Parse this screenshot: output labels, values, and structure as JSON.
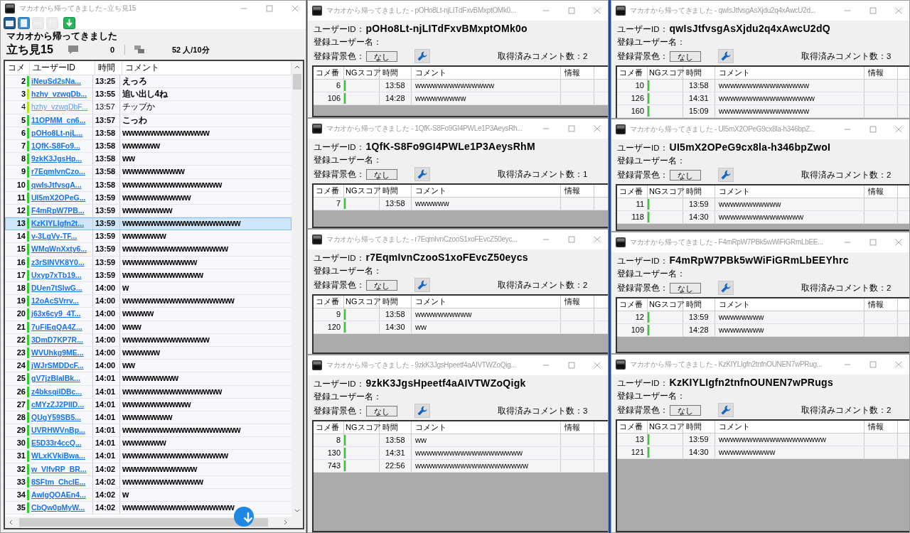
{
  "main_window": {
    "title": "マカオから帰ってきました - 立ち見15",
    "toolbar": [
      {
        "kind": "window",
        "disabled": false
      },
      {
        "kind": "document",
        "disabled": false
      },
      {
        "kind": "blank",
        "disabled": true
      },
      {
        "kind": "grid",
        "disabled": true
      },
      {
        "kind": "download",
        "disabled": false
      }
    ],
    "header": {
      "title": "マカオから帰ってきました",
      "room": "立ち見15",
      "comment_count": "0",
      "viewers": "52 人/10分"
    },
    "list": {
      "columns": [
        "コメ",
        "ユーザーID",
        "時間",
        "コメント"
      ],
      "rows": [
        {
          "no": "2",
          "user": "iNeuSd2sNa...",
          "time": "13:25",
          "comment": "えっろ",
          "color": "#33cc33",
          "bold": true,
          "selected": false
        },
        {
          "no": "3",
          "user": "hzhy_vzwqDb...",
          "time": "13:55",
          "comment": "追い出し4ね",
          "color": "#b5e61d",
          "bold": true,
          "selected": false
        },
        {
          "no": "4",
          "user": "hzhy_vzwqDbF...",
          "time": "13:57",
          "comment": "チップか",
          "color": "#b5e61d",
          "bold": false,
          "selected": false
        },
        {
          "no": "5",
          "user": "11OPMM_cn6...",
          "time": "13:57",
          "comment": "こっわ",
          "color": "#33cc33",
          "bold": true,
          "selected": false
        },
        {
          "no": "6",
          "user": "pOHo8Lt-njL...",
          "time": "13:58",
          "comment": "wwwwwwwwwwwwww",
          "color": "#33cc33",
          "bold": true,
          "selected": false
        },
        {
          "no": "7",
          "user": "1QfK-S8Fo9...",
          "time": "13:58",
          "comment": "wwwwww",
          "color": "#33cc33",
          "bold": true,
          "selected": false
        },
        {
          "no": "8",
          "user": "9zkK3JgsHp...",
          "time": "13:58",
          "comment": "ww",
          "color": "#33cc33",
          "bold": true,
          "selected": false
        },
        {
          "no": "9",
          "user": "r7EqmIvnCzo...",
          "time": "13:58",
          "comment": "wwwwwwwwww",
          "color": "#33cc33",
          "bold": true,
          "selected": false
        },
        {
          "no": "10",
          "user": "qwIsJtfvsgA...",
          "time": "13:58",
          "comment": "wwwwwwwwwwwwwwww",
          "color": "#33cc33",
          "bold": true,
          "selected": false
        },
        {
          "no": "11",
          "user": "UI5mX2OPeG...",
          "time": "13:59",
          "comment": "wwwwwwwwwww",
          "color": "#33cc33",
          "bold": true,
          "selected": false
        },
        {
          "no": "12",
          "user": "F4mRpW7PB...",
          "time": "13:59",
          "comment": "wwwwwwww",
          "color": "#33cc33",
          "bold": true,
          "selected": false
        },
        {
          "no": "13",
          "user": "KzKIYLIgfn2t...",
          "time": "13:59",
          "comment": "wwwwwwwwwwwwwwwwwww",
          "color": "#33cc33",
          "bold": true,
          "selected": true
        },
        {
          "no": "14",
          "user": "v-3LgVy-TF...",
          "time": "13:59",
          "comment": "wwwwwww",
          "color": "#33cc33",
          "bold": true,
          "selected": false
        },
        {
          "no": "15",
          "user": "WMqWnXxty6...",
          "time": "13:59",
          "comment": "wwwwwwwwwwwwwwwww",
          "color": "#33cc33",
          "bold": true,
          "selected": false
        },
        {
          "no": "16",
          "user": "z3rSINVK8Y0...",
          "time": "13:59",
          "comment": "wwwwwwwwwwww",
          "color": "#33cc33",
          "bold": true,
          "selected": false
        },
        {
          "no": "17",
          "user": "Uxyp7xTb19...",
          "time": "13:59",
          "comment": "wwwwwwwwwwwww",
          "color": "#33cc33",
          "bold": true,
          "selected": false
        },
        {
          "no": "18",
          "user": "DUen7tSlwG...",
          "time": "14:00",
          "comment": "w",
          "color": "#33cc33",
          "bold": true,
          "selected": false
        },
        {
          "no": "19",
          "user": "12oAcSVrrv...",
          "time": "14:00",
          "comment": "wwwwwwwwwwwwwwwwww",
          "color": "#33cc33",
          "bold": true,
          "selected": false
        },
        {
          "no": "20",
          "user": "j63x6cy9_4T...",
          "time": "14:00",
          "comment": "wwwww",
          "color": "#33cc33",
          "bold": true,
          "selected": false
        },
        {
          "no": "21",
          "user": "7uFiEqQA4Z...",
          "time": "14:00",
          "comment": "www",
          "color": "#33cc33",
          "bold": true,
          "selected": false
        },
        {
          "no": "22",
          "user": "3DmD7KP7R...",
          "time": "14:00",
          "comment": "wwwwwwwwwwwwww",
          "color": "#33cc33",
          "bold": true,
          "selected": false
        },
        {
          "no": "23",
          "user": "WVUhkg9ME...",
          "time": "14:00",
          "comment": "wwwwww",
          "color": "#33cc33",
          "bold": true,
          "selected": false
        },
        {
          "no": "24",
          "user": "jWJrSMDDcF...",
          "time": "14:00",
          "comment": "ww",
          "color": "#33cc33",
          "bold": true,
          "selected": false
        },
        {
          "no": "25",
          "user": "gV7jzBlaIBk...",
          "time": "14:01",
          "comment": "wwwwwwwww",
          "color": "#33cc33",
          "bold": true,
          "selected": false
        },
        {
          "no": "26",
          "user": "z4bksqilDBc...",
          "time": "14:01",
          "comment": "wwwwwwwwwwwwwwww",
          "color": "#33cc33",
          "bold": true,
          "selected": false
        },
        {
          "no": "27",
          "user": "cMYzZJ2PIID...",
          "time": "14:01",
          "comment": "wwwwwwwwwww",
          "color": "#33cc33",
          "bold": true,
          "selected": false
        },
        {
          "no": "28",
          "user": "QUgY59SB5...",
          "time": "14:01",
          "comment": "wwwwwwww",
          "color": "#33cc33",
          "bold": true,
          "selected": false
        },
        {
          "no": "29",
          "user": "UVRHWVnBp...",
          "time": "14:01",
          "comment": "wwwwwwwwwwwwwwwwwww",
          "color": "#33cc33",
          "bold": true,
          "selected": false
        },
        {
          "no": "30",
          "user": "E5D33r4ccQ...",
          "time": "14:01",
          "comment": "wwwwwww",
          "color": "#33cc33",
          "bold": true,
          "selected": false
        },
        {
          "no": "31",
          "user": "WLxKVkiBwa...",
          "time": "14:01",
          "comment": "wwwwwwwwwwwwwwwww",
          "color": "#33cc33",
          "bold": true,
          "selected": false
        },
        {
          "no": "32",
          "user": "w_VlfvRP_BR...",
          "time": "14:02",
          "comment": "wwwwwwwwwwww",
          "color": "#33cc33",
          "bold": true,
          "selected": false
        },
        {
          "no": "33",
          "user": "8SFtm_ChcIE...",
          "time": "14:02",
          "comment": "wwwwwwwwwwwww",
          "color": "#33cc33",
          "bold": true,
          "selected": false
        },
        {
          "no": "34",
          "user": "AwlgQOAEn4...",
          "time": "14:02",
          "comment": "w",
          "color": "#33cc33",
          "bold": true,
          "selected": false
        },
        {
          "no": "35",
          "user": "CbQw0pMyW...",
          "time": "14:02",
          "comment": "wwwwwwwwwwwwwwwwww",
          "color": "#33cc33",
          "bold": true,
          "selected": false
        }
      ]
    }
  },
  "user_windows": [
    {
      "title": "マカオから帰ってきました - pOHo8Lt-njLITdFxvBMxptOMk0...",
      "user_id_label": "ユーザーID：",
      "user_id": "pOHo8Lt-njLITdFxvBMxptOMk0o",
      "name_label": "登録ユーザー名：",
      "bg_label": "登録背景色：",
      "bg_value": "なし",
      "count_text": "取得済みコメント数：2",
      "columns": [
        "コメ番",
        "NGスコア",
        "時間",
        "コメント",
        "情報"
      ],
      "rows": [
        {
          "no": "6",
          "time": "13:58",
          "comment": "wwwwwwwwwwwwww"
        },
        {
          "no": "106",
          "time": "14:28",
          "comment": "wwwwwwwww"
        }
      ]
    },
    {
      "title": "マカオから帰ってきました - 1QfK-S8Fo9GI4PWLe1P3AeysRh...",
      "user_id_label": "ユーザーID：",
      "user_id": "1QfK-S8Fo9GI4PWLe1P3AeysRhM",
      "name_label": "登録ユーザー名：",
      "bg_label": "登録背景色：",
      "bg_value": "なし",
      "count_text": "取得済みコメント数：1",
      "columns": [
        "コメ番",
        "NGスコア",
        "時間",
        "コメント",
        "情報"
      ],
      "rows": [
        {
          "no": "7",
          "time": "13:58",
          "comment": "wwwwww"
        }
      ]
    },
    {
      "title": "マカオから帰ってきました - r7EqmIvnCzooS1xoFEvcZ50eyc...",
      "user_id_label": "ユーザーID：",
      "user_id": "r7EqmIvnCzooS1xoFEvcZ50eycs",
      "name_label": "登録ユーザー名：",
      "bg_label": "登録背景色：",
      "bg_value": "なし",
      "count_text": "取得済みコメント数：2",
      "columns": [
        "コメ番",
        "NGスコア",
        "時間",
        "コメント",
        "情報"
      ],
      "rows": [
        {
          "no": "9",
          "time": "13:58",
          "comment": "wwwwwwwwww"
        },
        {
          "no": "120",
          "time": "14:30",
          "comment": "ww"
        }
      ]
    },
    {
      "title": "マカオから帰ってきました - 9zkK3JgsHpeetf4aAIVTWZoQig...",
      "user_id_label": "ユーザーID：",
      "user_id": "9zkK3JgsHpeetf4aAIVTWZoQigk",
      "name_label": "登録ユーザー名：",
      "bg_label": "登録背景色：",
      "bg_value": "なし",
      "count_text": "取得済みコメント数：3",
      "columns": [
        "コメ番",
        "NGスコア",
        "時間",
        "コメント",
        "情報"
      ],
      "rows": [
        {
          "no": "8",
          "time": "13:58",
          "comment": "ww"
        },
        {
          "no": "130",
          "time": "14:31",
          "comment": "wwwwwwwwwwwwwwwwwww"
        },
        {
          "no": "743",
          "time": "22:56",
          "comment": "wwwwwwwwwwwwwwwwwwww"
        }
      ]
    },
    {
      "title": "マカオから帰ってきました - qwIsJtfvsgAsXjdu2q4xAwcU2d...",
      "user_id_label": "ユーザーID：",
      "user_id": "qwIsJtfvsgAsXjdu2q4xAwcU2dQ",
      "name_label": "登録ユーザー名：",
      "bg_label": "登録背景色：",
      "bg_value": "なし",
      "count_text": "取得済みコメント数：3",
      "columns": [
        "コメ番",
        "NGスコア",
        "時間",
        "コメント",
        "情報"
      ],
      "rows": [
        {
          "no": "10",
          "time": "13:58",
          "comment": "wwwwwwwwwwwwwwww"
        },
        {
          "no": "126",
          "time": "14:31",
          "comment": "wwwwwwwwwwwwwwwww"
        },
        {
          "no": "160",
          "time": "15:09",
          "comment": "wwwwwwwwwwwwwwww"
        }
      ]
    },
    {
      "title": "マカオから帰ってきました - UI5mX2OPeG9cx8la-h346bpZ...",
      "user_id_label": "ユーザーID：",
      "user_id": "UI5mX2OPeG9cx8la-h346bpZwoI",
      "name_label": "登録ユーザー名：",
      "bg_label": "登録背景色：",
      "bg_value": "なし",
      "count_text": "取得済みコメント数：2",
      "columns": [
        "コメ番",
        "NGスコア",
        "時間",
        "コメント",
        "情報"
      ],
      "rows": [
        {
          "no": "11",
          "time": "13:59",
          "comment": "wwwwwwwwwww"
        },
        {
          "no": "118",
          "time": "14:30",
          "comment": "wwwwwwwwwwwwwww"
        }
      ]
    },
    {
      "title": "マカオから帰ってきました - F4mRpW7PBk5wWiFiGRmLbEE...",
      "user_id_label": "ユーザーID：",
      "user_id": "F4mRpW7PBk5wWiFiGRmLbEEYhrc",
      "name_label": "登録ユーザー名：",
      "bg_label": "登録背景色：",
      "bg_value": "なし",
      "count_text": "取得済みコメント数：2",
      "columns": [
        "コメ番",
        "NGスコア",
        "時間",
        "コメント",
        "情報"
      ],
      "rows": [
        {
          "no": "12",
          "time": "13:59",
          "comment": "wwwwwwww"
        },
        {
          "no": "109",
          "time": "14:28",
          "comment": "wwwwwwww"
        }
      ]
    },
    {
      "title": "マカオから帰ってきました - KzKIYLIgfn2tnfnOUNEN7wPRug...",
      "user_id_label": "ユーザーID：",
      "user_id": "KzKIYLIgfn2tnfnOUNEN7wPRugs",
      "name_label": "登録ユーザー名：",
      "bg_label": "登録背景色：",
      "bg_value": "なし",
      "count_text": "取得済みコメント数：2",
      "columns": [
        "コメ番",
        "NGスコア",
        "時間",
        "コメント",
        "情報"
      ],
      "rows": [
        {
          "no": "13",
          "time": "13:59",
          "comment": "wwwwwwwwwwwwwwwwwww"
        },
        {
          "no": "121",
          "time": "14:30",
          "comment": "wwwwwwwwww"
        }
      ]
    }
  ]
}
